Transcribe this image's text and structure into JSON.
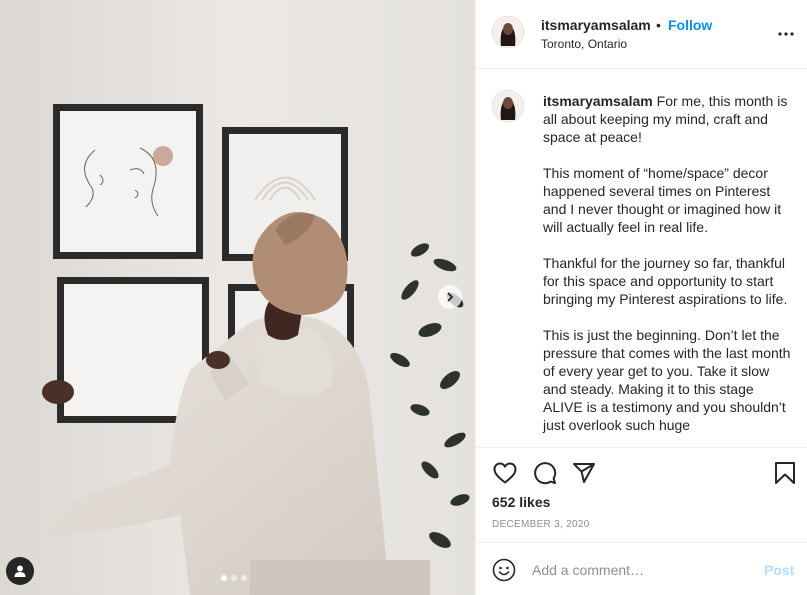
{
  "post": {
    "photo": {
      "alt_subject": "woman hanging framed art on a wall",
      "carousel": {
        "slides": 3,
        "active_index": 0
      }
    },
    "author": {
      "username": "itsmaryamsalam",
      "separator": "•",
      "follow_label": "Follow",
      "location": "Toronto, Ontario"
    },
    "caption": {
      "username": "itsmaryamsalam",
      "paragraphs": [
        "For me, this month is all about keeping my mind, craft and space at peace!",
        "This moment of “home/space” decor happened several times on Pinterest and I never thought or imagined how it will actually feel in real life.",
        "Thankful for the journey so far, thankful for this space and opportunity to start bringing my Pinterest aspirations to life.",
        "This is just the beginning. Don’t let the pressure that comes with the last month of every year get to you. Take it slow and steady. Making it to this stage ALIVE is a testimony and you shouldn’t just overlook such huge"
      ]
    },
    "likes_text": "652 likes",
    "date": "DECEMBER 3, 2020",
    "add_comment": {
      "placeholder": "Add a comment…",
      "post_label": "Post"
    },
    "colors": {
      "accent": "#0095f6",
      "post_disabled": "#b2dffc",
      "muted": "#8e8e8e",
      "text": "#262626",
      "divider": "#efefef"
    },
    "icons": [
      "heart-icon",
      "comment-icon",
      "share-icon",
      "bookmark-icon",
      "more-icon",
      "emoji-icon",
      "chevron-right-icon",
      "user-tag-icon"
    ]
  }
}
